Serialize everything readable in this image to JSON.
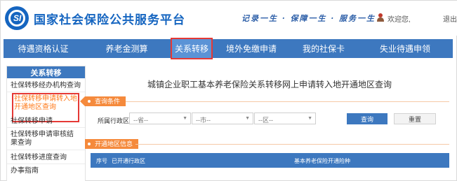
{
  "header": {
    "logo_text": "SI",
    "title": "国家社会保险公共服务平台",
    "slogan": "记录一生 · 保障一生 · 服务一生",
    "welcome": "欢迎您,",
    "logout": "退出"
  },
  "nav": {
    "items": [
      "待遇资格认证",
      "养老金测算",
      "关系转移",
      "境外免缴申请",
      "我的社保卡",
      "失业待遇申领"
    ],
    "active_index": 2
  },
  "sidebar": {
    "title": "关系转移",
    "items": [
      "社保转移经办机构查询",
      "社保转移申请转入地开通地区查询",
      "社保转移申请",
      "社保转移申请审核结果查询",
      "社保转移进度查询",
      "办事指南"
    ],
    "active_index": 1
  },
  "main": {
    "title": "城镇企业职工基本养老保险关系转移网上申请转入地开通地区查询",
    "query_tag": "查询条件",
    "area_label": "所属行政区:",
    "selects": [
      "--省--",
      "--市--",
      "--区--"
    ],
    "query_button": "查询",
    "reset_button": "重置",
    "result_tag": "开通地区信息",
    "table_headers": [
      "序号",
      "已开通行政区",
      "基本养老保险开通险种"
    ]
  },
  "colors": {
    "brand_blue": "#3d78bf",
    "accent_orange": "#f58a3c",
    "highlight_red": "#e53935"
  }
}
